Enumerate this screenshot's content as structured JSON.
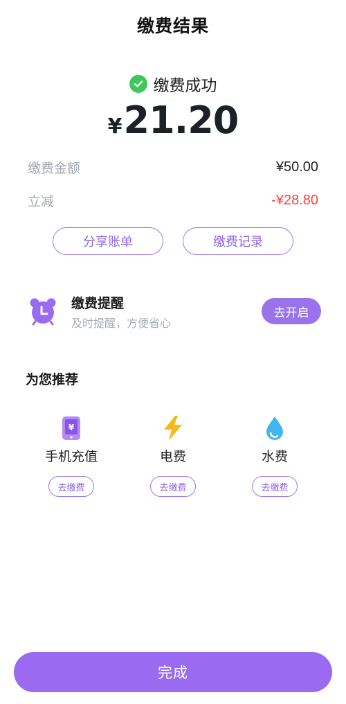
{
  "header": {
    "title": "缴费结果"
  },
  "result": {
    "status_text": "缴费成功",
    "currency": "¥",
    "amount": "21.20"
  },
  "details": [
    {
      "label": "缴费金额",
      "value": "¥50.00"
    },
    {
      "label": "立减",
      "value": "-¥28.80"
    }
  ],
  "actions": {
    "share_label": "分享账单",
    "records_label": "缴费记录"
  },
  "reminder": {
    "title": "缴费提醒",
    "subtitle": "及时提醒，方便省心",
    "button_label": "去开启"
  },
  "recommend": {
    "title": "为您推荐",
    "items": [
      {
        "name": "手机充值",
        "button": "去缴费",
        "icon": "phone-recharge-icon"
      },
      {
        "name": "电费",
        "button": "去缴费",
        "icon": "lightning-icon"
      },
      {
        "name": "水费",
        "button": "去缴费",
        "icon": "water-drop-icon"
      }
    ]
  },
  "footer": {
    "done_label": "完成"
  },
  "colors": {
    "accent": "#9a6bf0",
    "success": "#3ec85b",
    "discount": "#f2473d"
  }
}
